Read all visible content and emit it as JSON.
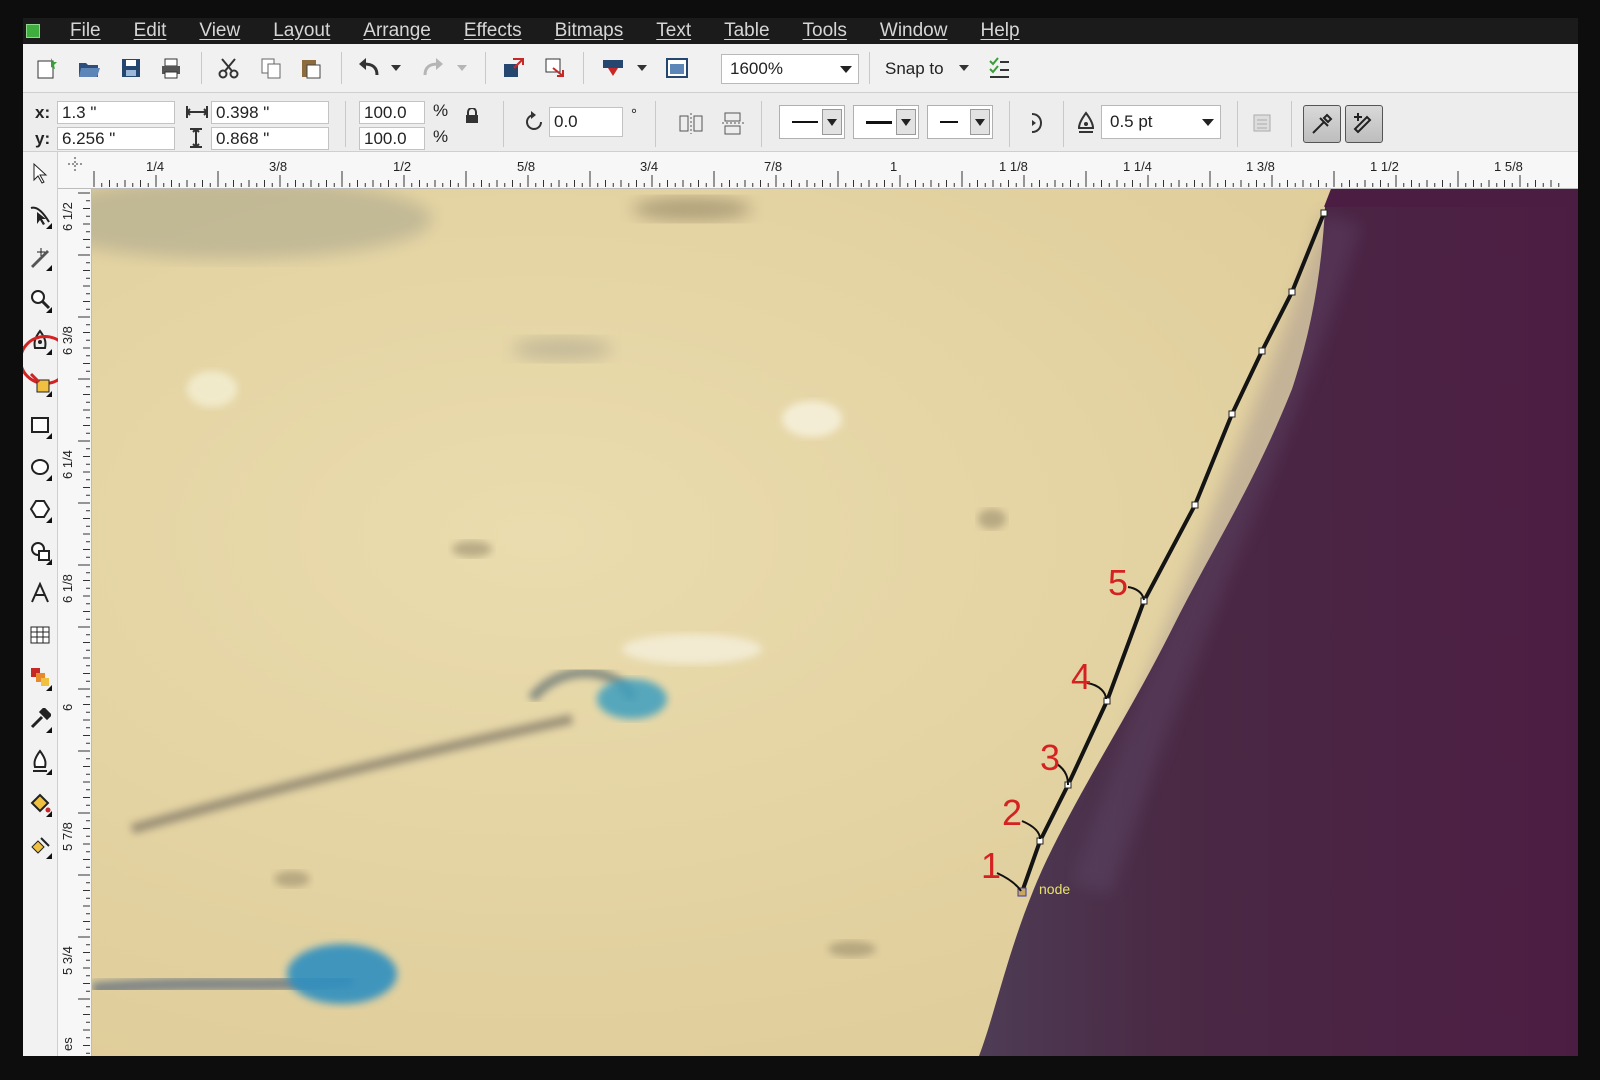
{
  "menu": [
    "File",
    "Edit",
    "View",
    "Layout",
    "Arrange",
    "Effects",
    "Bitmaps",
    "Text",
    "Table",
    "Tools",
    "Window",
    "Help"
  ],
  "toolbar": {
    "zoom": "1600%",
    "snap_label": "Snap to"
  },
  "properties": {
    "x_label": "x:",
    "x_value": "1.3 \"",
    "y_label": "y:",
    "y_value": "6.256 \"",
    "width_value": "0.398 \"",
    "height_value": "0.868 \"",
    "scale_w": "100.0",
    "scale_h": "100.0",
    "percent": "%",
    "rotation": "0.0",
    "degree": "°",
    "outline_width": "0.5 pt"
  },
  "ruler": {
    "horizontal": [
      "1/4",
      "3/8",
      "1/2",
      "5/8",
      "3/4",
      "7/8",
      "1",
      "1 1/8",
      "1 1/4",
      "1 3/8",
      "1 1/2",
      "1 5/8"
    ],
    "vertical": [
      "6 1/2",
      "6 3/8",
      "6 1/4",
      "6 1/8",
      "6",
      "5 7/8",
      "5 3/4"
    ],
    "unit_corner": "es"
  },
  "annotations": {
    "steps": [
      "1",
      "2",
      "3",
      "4",
      "5"
    ],
    "node_label": "node"
  },
  "colors": {
    "accent_red": "#d42222",
    "canvas_sand": "#e3d4a2",
    "canvas_purple": "#4a2740"
  },
  "tools": [
    "pick-tool",
    "shape-tool",
    "crop-tool",
    "zoom-tool",
    "freehand-tool",
    "smart-fill-tool",
    "rectangle-tool",
    "ellipse-tool",
    "polygon-tool",
    "basic-shapes-tool",
    "text-tool",
    "table-tool",
    "blend-tool",
    "eyedropper-tool",
    "outline-tool",
    "fill-tool",
    "interactive-fill-tool"
  ]
}
